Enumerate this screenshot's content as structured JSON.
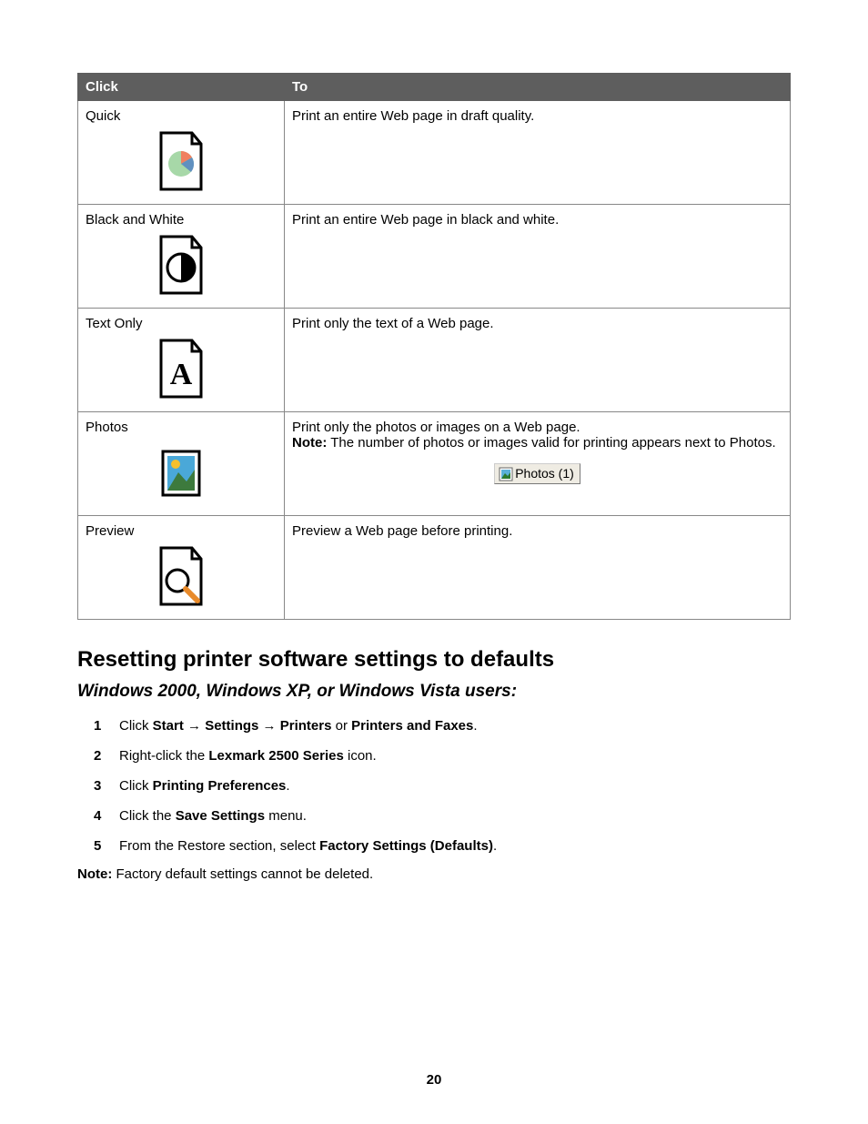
{
  "table": {
    "headers": {
      "col1": "Click",
      "col2": "To"
    },
    "rows": [
      {
        "label": "Quick",
        "desc": "Print an entire Web page in draft quality."
      },
      {
        "label": "Black and White",
        "desc": "Print an entire Web page in black and white."
      },
      {
        "label": "Text Only",
        "desc": "Print only the text of a Web page."
      },
      {
        "label": "Photos",
        "desc": "Print only the photos or images on a Web page.",
        "note_prefix": "Note:",
        "note_text": " The number of photos or images valid for printing appears next to Photos.",
        "badge": "Photos (1)"
      },
      {
        "label": "Preview",
        "desc": "Preview a Web page before printing."
      }
    ]
  },
  "section_heading": "Resetting printer software settings to defaults",
  "subsection_heading": "Windows 2000, Windows XP, or Windows Vista users:",
  "steps": [
    {
      "pre": "Click ",
      "b1": "Start",
      "arr1": " → ",
      "b2": "Settings",
      "arr2": " → ",
      "b3": "Printers",
      "mid": " or ",
      "b4": "Printers and Faxes",
      "post": "."
    },
    {
      "pre": "Right-click the ",
      "b1": "Lexmark 2500 Series",
      "post": " icon."
    },
    {
      "pre": "Click ",
      "b1": "Printing Preferences",
      "post": "."
    },
    {
      "pre": "Click the ",
      "b1": "Save Settings",
      "post": " menu."
    },
    {
      "pre": "From the Restore section, select ",
      "b1": "Factory Settings (Defaults)",
      "post": "."
    }
  ],
  "bottom_note_prefix": "Note:",
  "bottom_note_text": " Factory default settings cannot be deleted.",
  "page_number": "20"
}
